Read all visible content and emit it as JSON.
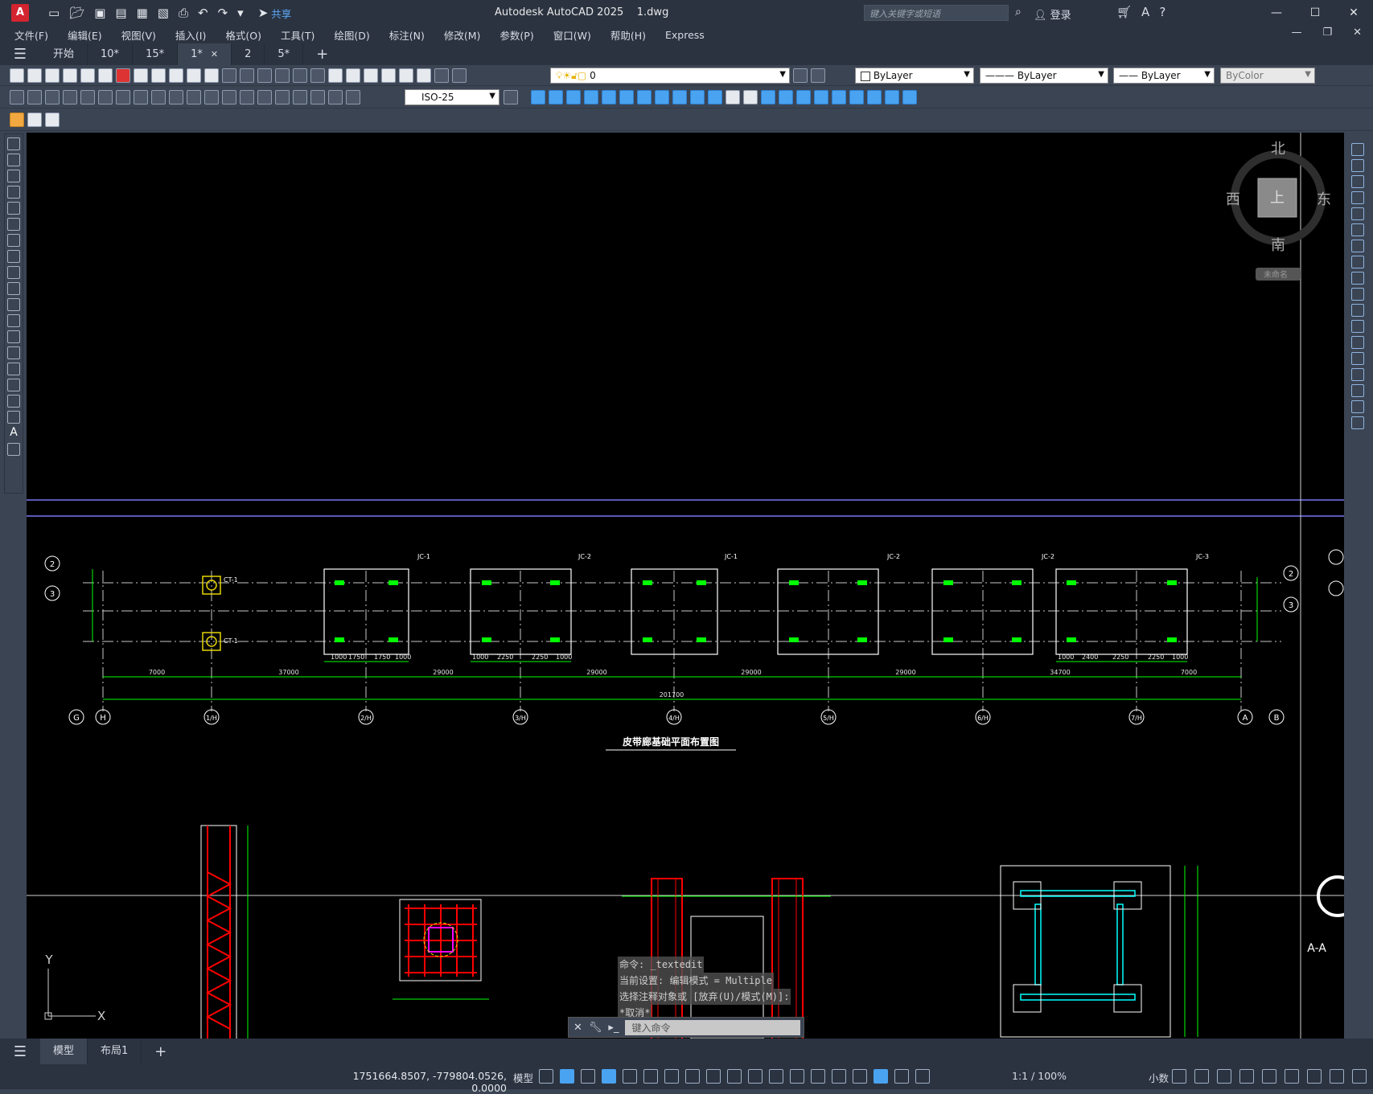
{
  "title_bar": {
    "app_icon": "A",
    "share_label": "共享",
    "title": "Autodesk AutoCAD 2025    1.dwg",
    "search_placeholder": "键入关键字或短语",
    "login_label": "登录",
    "window_buttons": {
      "minimize": "—",
      "maximize": "☐",
      "close": "✕"
    }
  },
  "menu_bar": {
    "items": [
      "文件(F)",
      "编辑(E)",
      "视图(V)",
      "插入(I)",
      "格式(O)",
      "工具(T)",
      "绘图(D)",
      "标注(N)",
      "修改(M)",
      "参数(P)",
      "窗口(W)",
      "帮助(H)",
      "Express"
    ],
    "doc_controls": {
      "minimize": "—",
      "restore": "❐",
      "close": "✕"
    }
  },
  "file_tabs": {
    "tabs": [
      "开始",
      "10*",
      "15*",
      "1*",
      "2",
      "5*"
    ],
    "active_index": 3,
    "new_tab_icon": "plus-icon"
  },
  "toolbar": {
    "layer_value": "0",
    "color_value": "ByLayer",
    "linetype_value": "ByLayer",
    "lineweight_value": "ByLayer",
    "plotstyle_value": "ByColor",
    "dim_style_value": "ISO-25"
  },
  "viewcube": {
    "north": "北",
    "south": "南",
    "east": "东",
    "west": "西",
    "face": "上",
    "ucs_label": "未命名"
  },
  "drawing": {
    "plan_title": "皮带廊基础平面布置图",
    "bottom_axis_labels": [
      "G",
      "H",
      "1/H",
      "2/H",
      "3/H",
      "4/H",
      "5/H",
      "6/H",
      "7/H",
      "A",
      "B"
    ],
    "left_axis_labels": [
      "2",
      "3"
    ],
    "right_axis_labels": [
      "2",
      "3"
    ],
    "foundation_tags": [
      "JC-1",
      "JC-2",
      "JC-1",
      "JC-2",
      "JC-2",
      "JC-3"
    ],
    "ct_labels": [
      "CT-1",
      "CT-1"
    ],
    "span_dims": [
      "7000",
      "37000",
      "29000",
      "29000",
      "29000",
      "29000",
      "34700",
      "7000"
    ],
    "total_dim": "201700",
    "dim_jc1": [
      "1000",
      "1750",
      "1750",
      "1000"
    ],
    "dim_jc2": [
      "1000",
      "2250",
      "2250",
      "1000"
    ],
    "dim_jc3": [
      "1000",
      "2400",
      "2250",
      "2250",
      "1000"
    ],
    "section_label": "A-A",
    "ucs_x": "X",
    "ucs_y": "Y"
  },
  "command_window": {
    "history": [
      "命令: _textedit",
      "当前设置: 编辑模式 = Multiple",
      "选择注释对象或 [放弃(U)/模式(M)]:",
      "*取消*"
    ],
    "input_placeholder": "键入命令"
  },
  "layout_tabs": {
    "tabs": [
      "模型",
      "布局1"
    ],
    "active_index": 0,
    "add_icon": "plus-icon"
  },
  "status_bar": {
    "coordinates": "1751664.8507, -779804.0526, 0.0000",
    "space": "模型",
    "annotation_scale": "1:1 / 100%",
    "units": "小数"
  },
  "colors": {
    "canvas": "#000000",
    "ui_dark": "#2b3340",
    "ui": "#3b4453",
    "green": "#00ff00",
    "red": "#ff0000",
    "magenta": "#ff00ff",
    "cyan": "#00ffff"
  }
}
